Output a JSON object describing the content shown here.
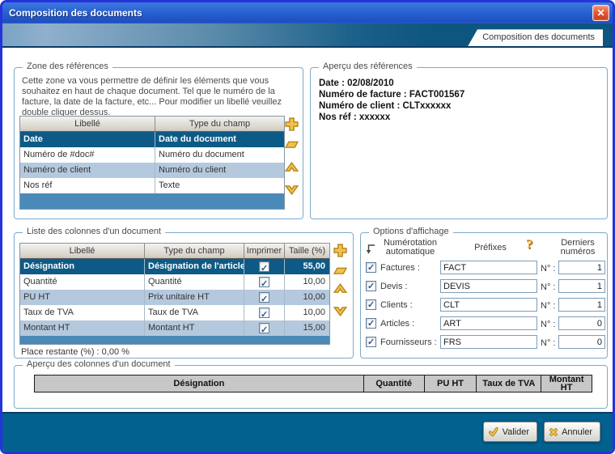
{
  "window": {
    "title": "Composition des documents",
    "close_glyph": "✕"
  },
  "tab": {
    "label": "Composition des documents"
  },
  "groups": {
    "zone": {
      "title": "Zone des références",
      "description": "Cette zone va vous permettre de définir les éléments que vous souhaitez en haut de chaque document. Tel que le numéro de la facture, la date de la facture, etc... Pour modifier un libellé veuillez double cliquer dessus.",
      "headers": [
        "Libellé",
        "Type du champ"
      ],
      "rows": [
        {
          "libelle": "Date",
          "type": "Date du document",
          "selected": true
        },
        {
          "libelle": "Numéro de #doc#",
          "type": "Numéro du document",
          "selected": false
        },
        {
          "libelle": "Numéro de client",
          "type": "Numéro du client",
          "selected": false
        },
        {
          "libelle": "Nos réf",
          "type": "Texte",
          "selected": false
        }
      ]
    },
    "apercu_ref": {
      "title": "Aperçu des références",
      "lines": [
        "Date : 02/08/2010",
        "Numéro de facture : FACT001567",
        "Numéro de client : CLTxxxxxx",
        "Nos réf : xxxxxx"
      ]
    },
    "liste": {
      "title": "Liste des colonnes d'un document",
      "headers": [
        "Libellé",
        "Type du champ",
        "Imprimer",
        "Taille (%)"
      ],
      "rows": [
        {
          "libelle": "Désignation",
          "type": "Désignation de l'article",
          "imprimer": true,
          "taille": "55,00",
          "selected": true
        },
        {
          "libelle": "Quantité",
          "type": "Quantité",
          "imprimer": true,
          "taille": "10,00",
          "selected": false
        },
        {
          "libelle": "PU HT",
          "type": "Prix unitaire HT",
          "imprimer": true,
          "taille": "10,00",
          "selected": false
        },
        {
          "libelle": "Taux de TVA",
          "type": "Taux de TVA",
          "imprimer": true,
          "taille": "10,00",
          "selected": false
        },
        {
          "libelle": "Montant HT",
          "type": "Montant HT",
          "imprimer": true,
          "taille": "15,00",
          "selected": false
        }
      ],
      "place_restante": "Place restante (%) :  0,00 %"
    },
    "options": {
      "title": "Options d'affichage",
      "header_numerotation": "Numérotation automatique",
      "header_prefixes": "Préfixes",
      "header_derniers": "Derniers numéros",
      "help_glyph": "?",
      "numero_label": "N° :",
      "rows": [
        {
          "label": "Factures :",
          "checked": true,
          "prefix": "FACT",
          "last": "1"
        },
        {
          "label": "Devis :",
          "checked": true,
          "prefix": "DEVIS",
          "last": "1"
        },
        {
          "label": "Clients :",
          "checked": true,
          "prefix": "CLT",
          "last": "1"
        },
        {
          "label": "Articles :",
          "checked": true,
          "prefix": "ART",
          "last": "0"
        },
        {
          "label": "Fournisseurs :",
          "checked": true,
          "prefix": "FRS",
          "last": "0"
        }
      ]
    },
    "apercu_col": {
      "title": "Aperçu des colonnes d'un document",
      "headers": [
        "Désignation",
        "Quantité",
        "PU HT",
        "Taux de TVA",
        "Montant HT"
      ]
    }
  },
  "footer": {
    "valider": "Valider",
    "annuler": "Annuler"
  },
  "colors": {
    "titlebar_blue": "#2a62d2",
    "banner_dark_teal": "#0c5680",
    "dialog_border": "#2633d9",
    "selection_blue": "#0e5a86",
    "stripe_blue": "#b5c9de",
    "filler_blue": "#4a8ab8",
    "footer_teal": "#02618e",
    "accent_gold": "#f0bc42"
  }
}
